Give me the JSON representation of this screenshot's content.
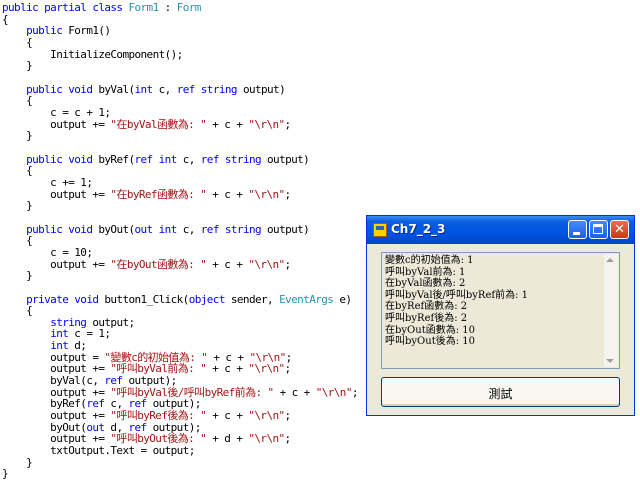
{
  "code_lines": [
    [
      [
        "kw",
        "public partial class "
      ],
      [
        "ty",
        "Form1"
      ],
      [
        "pl",
        " : "
      ],
      [
        "ty",
        "Form"
      ]
    ],
    [
      [
        "pl",
        "{"
      ]
    ],
    [
      [
        "pl",
        "    "
      ],
      [
        "kw",
        "public "
      ],
      [
        "pl",
        "Form1()"
      ]
    ],
    [
      [
        "pl",
        "    {"
      ]
    ],
    [
      [
        "pl",
        "        InitializeComponent();"
      ]
    ],
    [
      [
        "pl",
        "    }"
      ]
    ],
    [
      [
        "pl",
        ""
      ]
    ],
    [
      [
        "pl",
        "    "
      ],
      [
        "kw",
        "public void "
      ],
      [
        "pl",
        "byVal("
      ],
      [
        "kw",
        "int "
      ],
      [
        "pl",
        "c, "
      ],
      [
        "kw",
        "ref string "
      ],
      [
        "pl",
        "output)"
      ]
    ],
    [
      [
        "pl",
        "    {"
      ]
    ],
    [
      [
        "pl",
        "        c = c + 1;"
      ]
    ],
    [
      [
        "pl",
        "        output += "
      ],
      [
        "st",
        "\"在byVal函數為: \""
      ],
      [
        "pl",
        " + c + "
      ],
      [
        "st",
        "\"\\r\\n\""
      ],
      [
        "pl",
        ";"
      ]
    ],
    [
      [
        "pl",
        "    }"
      ]
    ],
    [
      [
        "pl",
        ""
      ]
    ],
    [
      [
        "pl",
        "    "
      ],
      [
        "kw",
        "public void "
      ],
      [
        "pl",
        "byRef("
      ],
      [
        "kw",
        "ref int "
      ],
      [
        "pl",
        "c, "
      ],
      [
        "kw",
        "ref string "
      ],
      [
        "pl",
        "output)"
      ]
    ],
    [
      [
        "pl",
        "    {"
      ]
    ],
    [
      [
        "pl",
        "        c += 1;"
      ]
    ],
    [
      [
        "pl",
        "        output += "
      ],
      [
        "st",
        "\"在byRef函數為: \""
      ],
      [
        "pl",
        " + c + "
      ],
      [
        "st",
        "\"\\r\\n\""
      ],
      [
        "pl",
        ";"
      ]
    ],
    [
      [
        "pl",
        "    }"
      ]
    ],
    [
      [
        "pl",
        ""
      ]
    ],
    [
      [
        "pl",
        "    "
      ],
      [
        "kw",
        "public void "
      ],
      [
        "pl",
        "byOut("
      ],
      [
        "kw",
        "out int "
      ],
      [
        "pl",
        "c, "
      ],
      [
        "kw",
        "ref string "
      ],
      [
        "pl",
        "output)"
      ]
    ],
    [
      [
        "pl",
        "    {"
      ]
    ],
    [
      [
        "pl",
        "        c = 10;"
      ]
    ],
    [
      [
        "pl",
        "        output += "
      ],
      [
        "st",
        "\"在byOut函數為: \""
      ],
      [
        "pl",
        " + c + "
      ],
      [
        "st",
        "\"\\r\\n\""
      ],
      [
        "pl",
        ";"
      ]
    ],
    [
      [
        "pl",
        "    }"
      ]
    ],
    [
      [
        "pl",
        ""
      ]
    ],
    [
      [
        "pl",
        "    "
      ],
      [
        "kw",
        "private void "
      ],
      [
        "pl",
        "button1_Click("
      ],
      [
        "kw",
        "object "
      ],
      [
        "pl",
        "sender, "
      ],
      [
        "ty",
        "EventArgs "
      ],
      [
        "pl",
        "e)"
      ]
    ],
    [
      [
        "pl",
        "    {"
      ]
    ],
    [
      [
        "pl",
        "        "
      ],
      [
        "kw",
        "string "
      ],
      [
        "pl",
        "output;"
      ]
    ],
    [
      [
        "pl",
        "        "
      ],
      [
        "kw",
        "int "
      ],
      [
        "pl",
        "c = 1;"
      ]
    ],
    [
      [
        "pl",
        "        "
      ],
      [
        "kw",
        "int "
      ],
      [
        "pl",
        "d;"
      ]
    ],
    [
      [
        "pl",
        "        output = "
      ],
      [
        "st",
        "\"變數c的初始值為: \""
      ],
      [
        "pl",
        " + c + "
      ],
      [
        "st",
        "\"\\r\\n\""
      ],
      [
        "pl",
        ";"
      ]
    ],
    [
      [
        "pl",
        "        output += "
      ],
      [
        "st",
        "\"呼叫byVal前為: \""
      ],
      [
        "pl",
        " + c + "
      ],
      [
        "st",
        "\"\\r\\n\""
      ],
      [
        "pl",
        ";"
      ]
    ],
    [
      [
        "pl",
        "        byVal(c, "
      ],
      [
        "kw",
        "ref "
      ],
      [
        "pl",
        "output);"
      ]
    ],
    [
      [
        "pl",
        "        output += "
      ],
      [
        "st",
        "\"呼叫byVal後/呼叫byRef前為: \""
      ],
      [
        "pl",
        " + c + "
      ],
      [
        "st",
        "\"\\r\\n\""
      ],
      [
        "pl",
        ";"
      ]
    ],
    [
      [
        "pl",
        "        byRef("
      ],
      [
        "kw",
        "ref "
      ],
      [
        "pl",
        "c, "
      ],
      [
        "kw",
        "ref "
      ],
      [
        "pl",
        "output);"
      ]
    ],
    [
      [
        "pl",
        "        output += "
      ],
      [
        "st",
        "\"呼叫byRef後為: \""
      ],
      [
        "pl",
        " + c + "
      ],
      [
        "st",
        "\"\\r\\n\""
      ],
      [
        "pl",
        ";"
      ]
    ],
    [
      [
        "pl",
        "        byOut("
      ],
      [
        "kw",
        "out "
      ],
      [
        "pl",
        "d, "
      ],
      [
        "kw",
        "ref "
      ],
      [
        "pl",
        "output);"
      ]
    ],
    [
      [
        "pl",
        "        output += "
      ],
      [
        "st",
        "\"呼叫byOut後為: \""
      ],
      [
        "pl",
        " + d + "
      ],
      [
        "st",
        "\"\\r\\n\""
      ],
      [
        "pl",
        ";"
      ]
    ],
    [
      [
        "pl",
        "        txtOutput.Text = output;"
      ]
    ],
    [
      [
        "pl",
        "    }"
      ]
    ],
    [
      [
        "pl",
        "}"
      ]
    ]
  ],
  "window": {
    "title": "Ch7_2_3",
    "close_glyph": "✕",
    "output_text": "變數c的初始值為: 1\n呼叫byVal前為: 1\n在byVal函數為: 2\n呼叫byVal後/呼叫byRef前為: 1\n在byRef函數為: 2\n呼叫byRef後為: 2\n在byOut函數為: 10\n呼叫byOut後為: 10",
    "button_label": "測試"
  },
  "colors": {
    "keyword": "#0000ff",
    "type": "#2b91af",
    "string": "#a31515",
    "titlebar": "#0054e3"
  }
}
